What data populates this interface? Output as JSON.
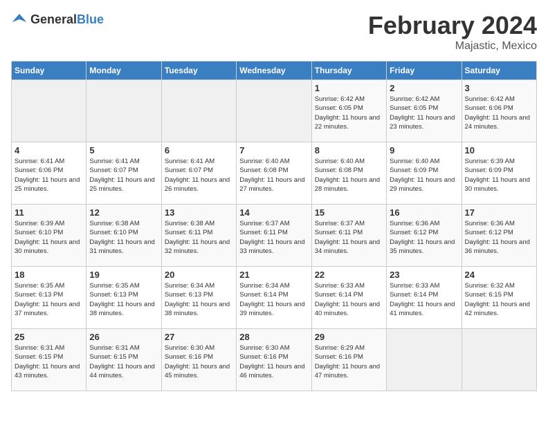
{
  "header": {
    "logo_general": "General",
    "logo_blue": "Blue",
    "title": "February 2024",
    "subtitle": "Majastic, Mexico"
  },
  "days_of_week": [
    "Sunday",
    "Monday",
    "Tuesday",
    "Wednesday",
    "Thursday",
    "Friday",
    "Saturday"
  ],
  "weeks": [
    [
      {
        "day": "",
        "sunrise": "",
        "sunset": "",
        "daylight": ""
      },
      {
        "day": "",
        "sunrise": "",
        "sunset": "",
        "daylight": ""
      },
      {
        "day": "",
        "sunrise": "",
        "sunset": "",
        "daylight": ""
      },
      {
        "day": "",
        "sunrise": "",
        "sunset": "",
        "daylight": ""
      },
      {
        "day": "1",
        "sunrise": "Sunrise: 6:42 AM",
        "sunset": "Sunset: 6:05 PM",
        "daylight": "Daylight: 11 hours and 22 minutes."
      },
      {
        "day": "2",
        "sunrise": "Sunrise: 6:42 AM",
        "sunset": "Sunset: 6:05 PM",
        "daylight": "Daylight: 11 hours and 23 minutes."
      },
      {
        "day": "3",
        "sunrise": "Sunrise: 6:42 AM",
        "sunset": "Sunset: 6:06 PM",
        "daylight": "Daylight: 11 hours and 24 minutes."
      }
    ],
    [
      {
        "day": "4",
        "sunrise": "Sunrise: 6:41 AM",
        "sunset": "Sunset: 6:06 PM",
        "daylight": "Daylight: 11 hours and 25 minutes."
      },
      {
        "day": "5",
        "sunrise": "Sunrise: 6:41 AM",
        "sunset": "Sunset: 6:07 PM",
        "daylight": "Daylight: 11 hours and 25 minutes."
      },
      {
        "day": "6",
        "sunrise": "Sunrise: 6:41 AM",
        "sunset": "Sunset: 6:07 PM",
        "daylight": "Daylight: 11 hours and 26 minutes."
      },
      {
        "day": "7",
        "sunrise": "Sunrise: 6:40 AM",
        "sunset": "Sunset: 6:08 PM",
        "daylight": "Daylight: 11 hours and 27 minutes."
      },
      {
        "day": "8",
        "sunrise": "Sunrise: 6:40 AM",
        "sunset": "Sunset: 6:08 PM",
        "daylight": "Daylight: 11 hours and 28 minutes."
      },
      {
        "day": "9",
        "sunrise": "Sunrise: 6:40 AM",
        "sunset": "Sunset: 6:09 PM",
        "daylight": "Daylight: 11 hours and 29 minutes."
      },
      {
        "day": "10",
        "sunrise": "Sunrise: 6:39 AM",
        "sunset": "Sunset: 6:09 PM",
        "daylight": "Daylight: 11 hours and 30 minutes."
      }
    ],
    [
      {
        "day": "11",
        "sunrise": "Sunrise: 6:39 AM",
        "sunset": "Sunset: 6:10 PM",
        "daylight": "Daylight: 11 hours and 30 minutes."
      },
      {
        "day": "12",
        "sunrise": "Sunrise: 6:38 AM",
        "sunset": "Sunset: 6:10 PM",
        "daylight": "Daylight: 11 hours and 31 minutes."
      },
      {
        "day": "13",
        "sunrise": "Sunrise: 6:38 AM",
        "sunset": "Sunset: 6:11 PM",
        "daylight": "Daylight: 11 hours and 32 minutes."
      },
      {
        "day": "14",
        "sunrise": "Sunrise: 6:37 AM",
        "sunset": "Sunset: 6:11 PM",
        "daylight": "Daylight: 11 hours and 33 minutes."
      },
      {
        "day": "15",
        "sunrise": "Sunrise: 6:37 AM",
        "sunset": "Sunset: 6:11 PM",
        "daylight": "Daylight: 11 hours and 34 minutes."
      },
      {
        "day": "16",
        "sunrise": "Sunrise: 6:36 AM",
        "sunset": "Sunset: 6:12 PM",
        "daylight": "Daylight: 11 hours and 35 minutes."
      },
      {
        "day": "17",
        "sunrise": "Sunrise: 6:36 AM",
        "sunset": "Sunset: 6:12 PM",
        "daylight": "Daylight: 11 hours and 36 minutes."
      }
    ],
    [
      {
        "day": "18",
        "sunrise": "Sunrise: 6:35 AM",
        "sunset": "Sunset: 6:13 PM",
        "daylight": "Daylight: 11 hours and 37 minutes."
      },
      {
        "day": "19",
        "sunrise": "Sunrise: 6:35 AM",
        "sunset": "Sunset: 6:13 PM",
        "daylight": "Daylight: 11 hours and 38 minutes."
      },
      {
        "day": "20",
        "sunrise": "Sunrise: 6:34 AM",
        "sunset": "Sunset: 6:13 PM",
        "daylight": "Daylight: 11 hours and 38 minutes."
      },
      {
        "day": "21",
        "sunrise": "Sunrise: 6:34 AM",
        "sunset": "Sunset: 6:14 PM",
        "daylight": "Daylight: 11 hours and 39 minutes."
      },
      {
        "day": "22",
        "sunrise": "Sunrise: 6:33 AM",
        "sunset": "Sunset: 6:14 PM",
        "daylight": "Daylight: 11 hours and 40 minutes."
      },
      {
        "day": "23",
        "sunrise": "Sunrise: 6:33 AM",
        "sunset": "Sunset: 6:14 PM",
        "daylight": "Daylight: 11 hours and 41 minutes."
      },
      {
        "day": "24",
        "sunrise": "Sunrise: 6:32 AM",
        "sunset": "Sunset: 6:15 PM",
        "daylight": "Daylight: 11 hours and 42 minutes."
      }
    ],
    [
      {
        "day": "25",
        "sunrise": "Sunrise: 6:31 AM",
        "sunset": "Sunset: 6:15 PM",
        "daylight": "Daylight: 11 hours and 43 minutes."
      },
      {
        "day": "26",
        "sunrise": "Sunrise: 6:31 AM",
        "sunset": "Sunset: 6:15 PM",
        "daylight": "Daylight: 11 hours and 44 minutes."
      },
      {
        "day": "27",
        "sunrise": "Sunrise: 6:30 AM",
        "sunset": "Sunset: 6:16 PM",
        "daylight": "Daylight: 11 hours and 45 minutes."
      },
      {
        "day": "28",
        "sunrise": "Sunrise: 6:30 AM",
        "sunset": "Sunset: 6:16 PM",
        "daylight": "Daylight: 11 hours and 46 minutes."
      },
      {
        "day": "29",
        "sunrise": "Sunrise: 6:29 AM",
        "sunset": "Sunset: 6:16 PM",
        "daylight": "Daylight: 11 hours and 47 minutes."
      },
      {
        "day": "",
        "sunrise": "",
        "sunset": "",
        "daylight": ""
      },
      {
        "day": "",
        "sunrise": "",
        "sunset": "",
        "daylight": ""
      }
    ]
  ]
}
